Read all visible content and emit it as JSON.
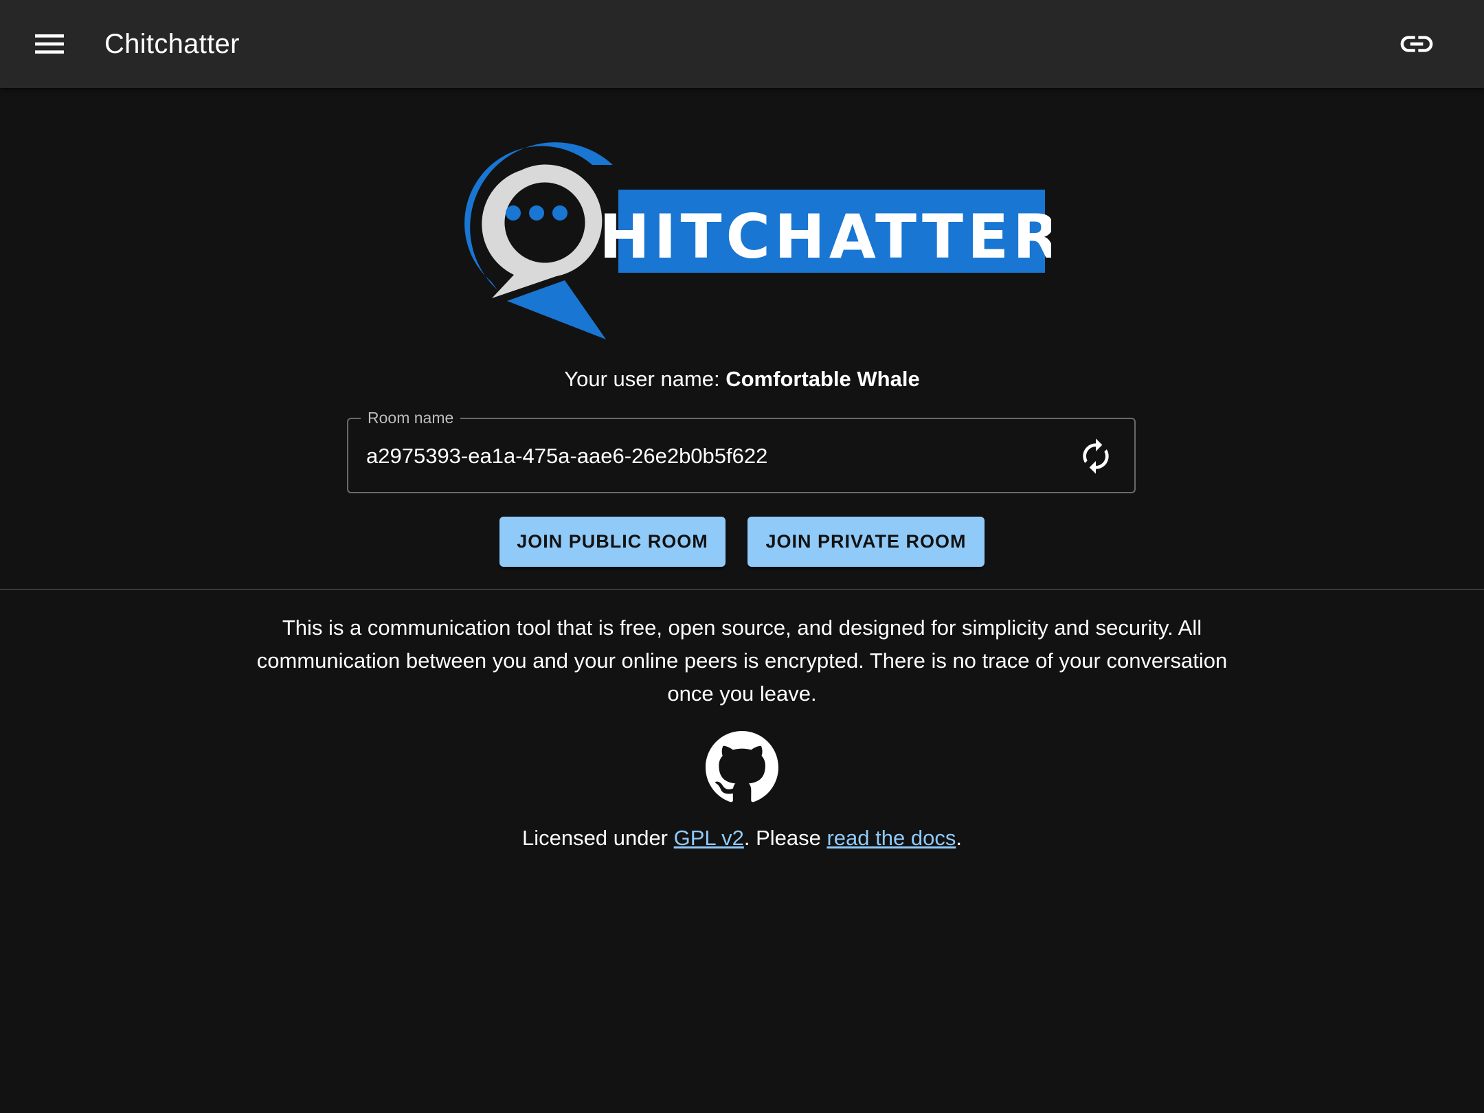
{
  "appbar": {
    "title": "Chitchatter",
    "menu_icon": "menu-icon",
    "link_icon": "link-icon"
  },
  "logo": {
    "text": "HITCHATTER",
    "primary_color": "#1976d2",
    "secondary_color": "#d9d9d9"
  },
  "user": {
    "label": "Your user name:",
    "name": "Comfortable Whale"
  },
  "room": {
    "label": "Room name",
    "value": "a2975393-ea1a-475a-aae6-26e2b0b5f622",
    "refresh_icon": "refresh-icon"
  },
  "actions": {
    "join_public": "JOIN PUBLIC ROOM",
    "join_private": "JOIN PRIVATE ROOM"
  },
  "description": "This is a communication tool that is free, open source, and designed for simplicity and security. All communication between you and your online peers is encrypted. There is no trace of your conversation once you leave.",
  "footer": {
    "github_icon": "github-icon",
    "license_prefix": "Licensed under ",
    "license_link": "GPL v2",
    "middle": ". Please ",
    "docs_link": "read the docs",
    "suffix": "."
  },
  "colors": {
    "background": "#121212",
    "appbar": "#272727",
    "accent": "#90caf9"
  }
}
